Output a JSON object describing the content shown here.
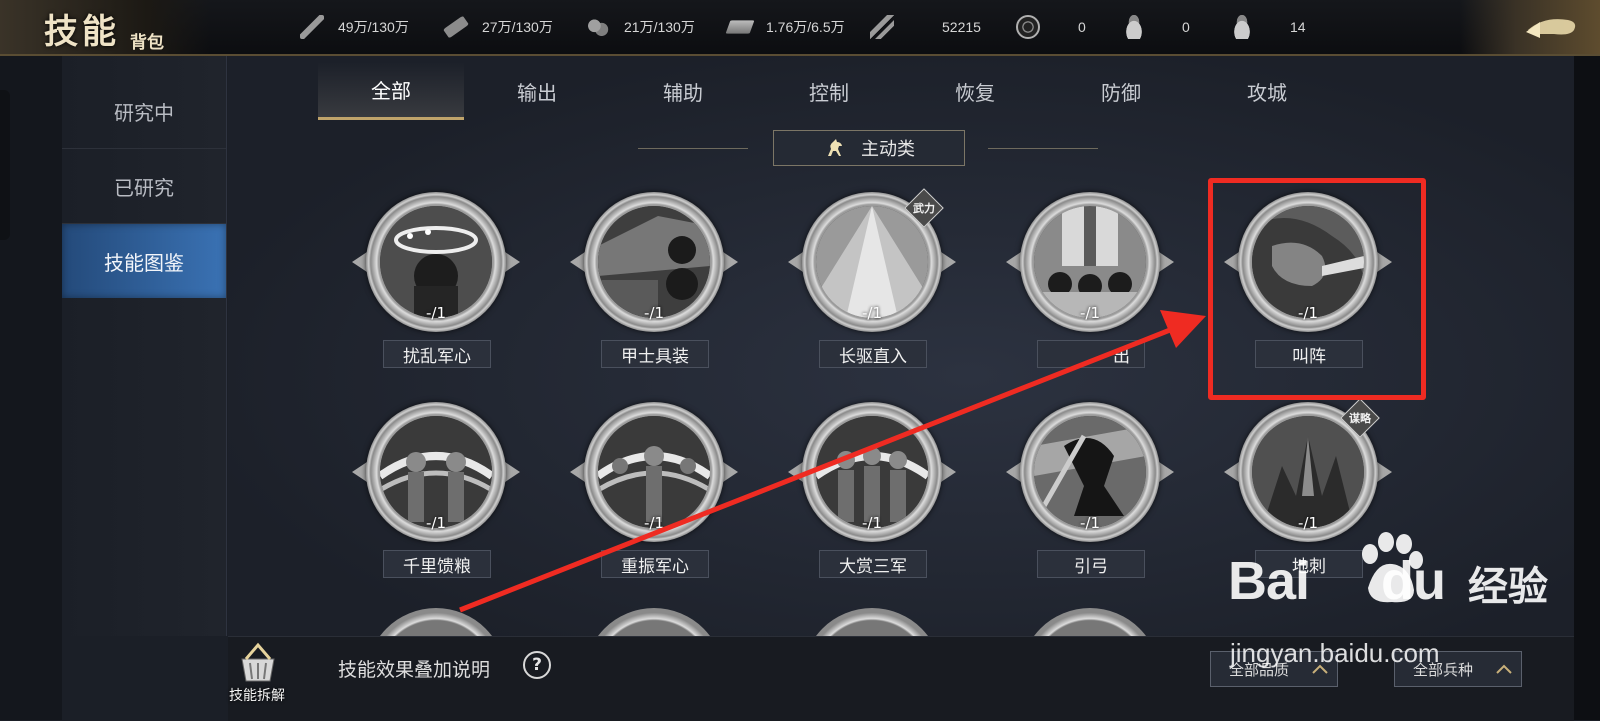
{
  "header": {
    "title_main": "技能",
    "title_sub": "背包",
    "resources": [
      {
        "icon": "grain-icon",
        "value": "49万/130万"
      },
      {
        "icon": "wood-icon",
        "value": "27万/130万"
      },
      {
        "icon": "stone-icon",
        "value": "21万/130万"
      },
      {
        "icon": "iron-icon",
        "value": "1.76万/6.5万"
      },
      {
        "icon": "order-icon",
        "value": "52215"
      },
      {
        "icon": "copper-coin-icon",
        "value": "0"
      },
      {
        "icon": "gold-ingot-icon",
        "value": "0"
      },
      {
        "icon": "silver-ingot-icon",
        "value": "14"
      }
    ]
  },
  "sidebar": {
    "items": [
      {
        "label": "研究中"
      },
      {
        "label": "已研究"
      },
      {
        "label": "技能图鉴",
        "active": true
      }
    ]
  },
  "tabs": [
    {
      "label": "全部",
      "active": true
    },
    {
      "label": "输出"
    },
    {
      "label": "辅助"
    },
    {
      "label": "控制"
    },
    {
      "label": "恢复"
    },
    {
      "label": "防御"
    },
    {
      "label": "攻城"
    }
  ],
  "section": {
    "label": "主动类"
  },
  "skills": [
    {
      "name": "扰乱军心",
      "count": "-/1"
    },
    {
      "name": "甲士具装",
      "count": "-/1"
    },
    {
      "name": "长驱直入",
      "count": "-/1",
      "badge": "武力"
    },
    {
      "name": "",
      "partial_name": "出",
      "count": "-/1"
    },
    {
      "name": "叫阵",
      "count": "-/1"
    },
    {
      "name": "千里馈粮",
      "count": "-/1"
    },
    {
      "name": "重振军心",
      "count": "-/1"
    },
    {
      "name": "大赏三军",
      "count": "-/1"
    },
    {
      "name": "引弓",
      "count": "-/1"
    },
    {
      "name": "地刺",
      "count": "-/1",
      "badge": "谋略"
    }
  ],
  "bottom": {
    "decompose_label": "技能拆解",
    "explain_label": "技能效果叠加说明",
    "help_symbol": "?",
    "quality_filter": "全部品质",
    "troop_filter": "全部兵种"
  },
  "watermark": {
    "brand": "Bai",
    "brand_du": "du",
    "jingyan": "经验",
    "url": "jingyan.baidu.com"
  },
  "colors": {
    "accent_gold": "#c0a46b",
    "sidebar_active": "#3a72b4",
    "annotation_red": "#ef2b22"
  }
}
